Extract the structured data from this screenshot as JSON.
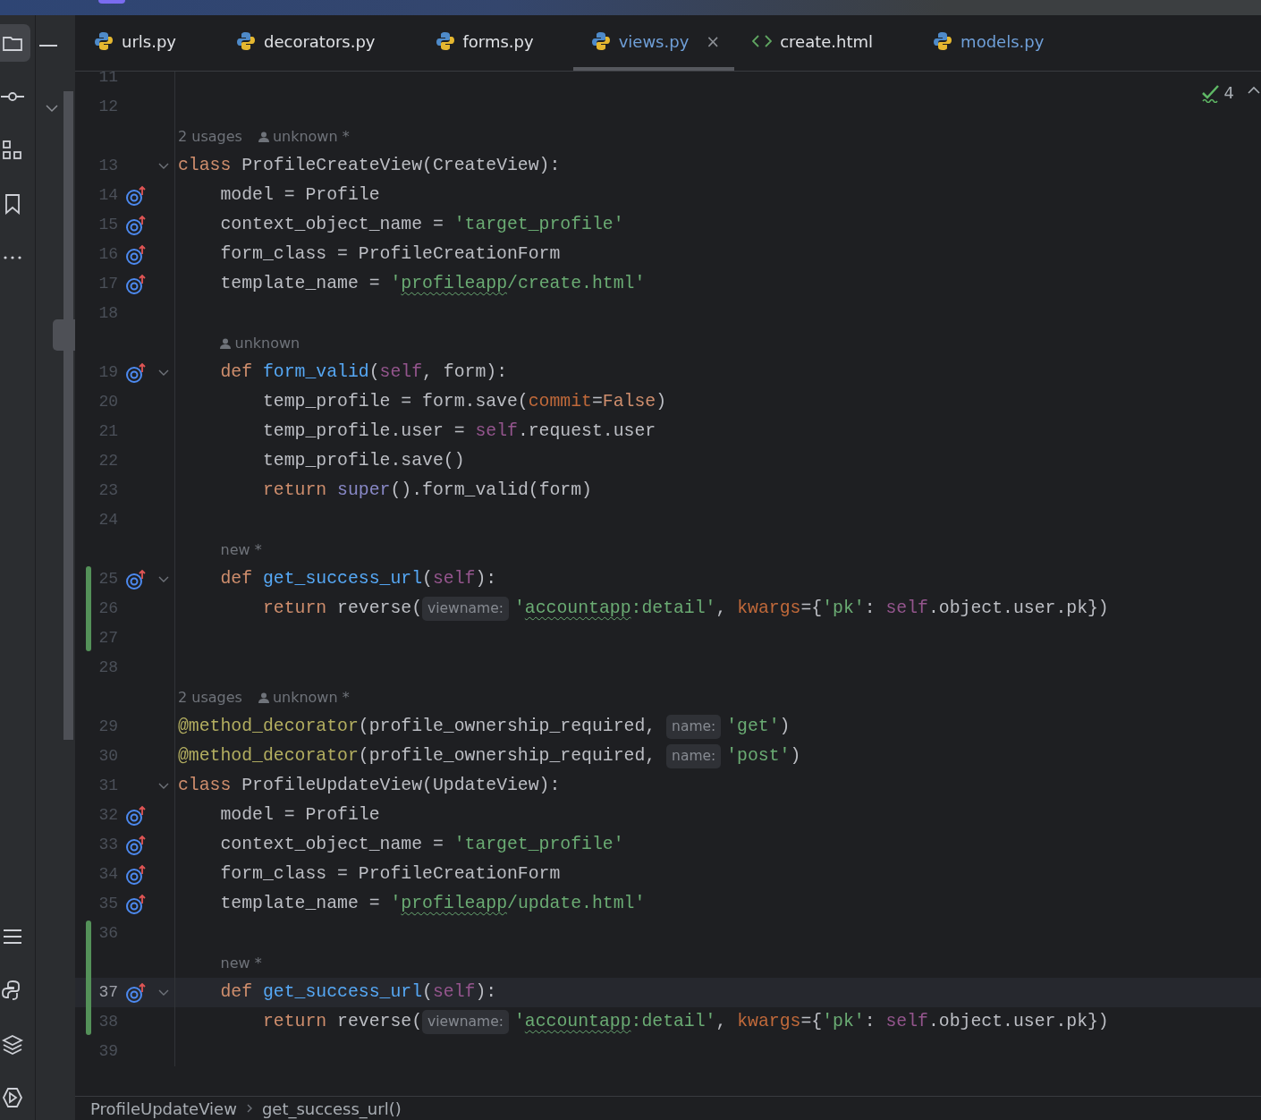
{
  "left_toolbar": {
    "top": [
      {
        "kind": "project",
        "selected": true
      },
      {
        "kind": "commit",
        "selected": false
      },
      {
        "kind": "structure",
        "selected": false
      },
      {
        "kind": "bookmarks",
        "selected": false
      },
      {
        "kind": "more",
        "selected": false
      }
    ],
    "bottom": [
      {
        "kind": "todo",
        "selected": false
      },
      {
        "kind": "python",
        "selected": false
      },
      {
        "kind": "layers",
        "selected": false
      },
      {
        "kind": "run",
        "selected": false
      }
    ]
  },
  "tabs": [
    {
      "label": "urls.py",
      "kind": "python",
      "selected": false,
      "modified": false
    },
    {
      "label": "decorators.py",
      "kind": "python",
      "selected": false,
      "modified": false
    },
    {
      "label": "forms.py",
      "kind": "python",
      "selected": false,
      "modified": false
    },
    {
      "label": "views.py",
      "kind": "python",
      "selected": true,
      "modified": true,
      "close": "×"
    },
    {
      "label": "create.html",
      "kind": "html",
      "selected": false,
      "modified": false
    },
    {
      "label": "models.py",
      "kind": "python",
      "selected": false,
      "modified": true
    }
  ],
  "problems": {
    "count": "4"
  },
  "rows": [
    {
      "number": "11",
      "fold": false,
      "override": false,
      "changed": false,
      "current": false,
      "tokens": []
    },
    {
      "number": "12",
      "fold": false,
      "override": false,
      "changed": false,
      "current": false,
      "tokens": []
    },
    {
      "number": "13",
      "fold": true,
      "override": false,
      "changed": false,
      "current": false,
      "above": [
        {
          "kind": "usages",
          "text": "2 usages"
        },
        {
          "kind": "author",
          "text": "unknown *"
        }
      ],
      "tokens": [
        {
          "kind": "keyword",
          "text": "class"
        },
        {
          "kind": "plain",
          "text": " ProfileCreateView(CreateView):"
        }
      ]
    },
    {
      "number": "14",
      "fold": false,
      "override": true,
      "changed": false,
      "current": false,
      "tokens": [
        {
          "kind": "plain",
          "text": "    model = Profile"
        }
      ]
    },
    {
      "number": "15",
      "fold": false,
      "override": true,
      "changed": false,
      "current": false,
      "tokens": [
        {
          "kind": "plain",
          "text": "    context_object_name = "
        },
        {
          "kind": "string",
          "text": "'target_profile'"
        }
      ]
    },
    {
      "number": "16",
      "fold": false,
      "override": true,
      "changed": false,
      "current": false,
      "tokens": [
        {
          "kind": "plain",
          "text": "    form_class = ProfileCreationForm"
        }
      ]
    },
    {
      "number": "17",
      "fold": false,
      "override": true,
      "changed": false,
      "current": false,
      "tokens": [
        {
          "kind": "plain",
          "text": "    template_name = "
        },
        {
          "kind": "string",
          "text": "'"
        },
        {
          "kind": "string",
          "text": "profileapp",
          "typo": true
        },
        {
          "kind": "string",
          "text": "/create.html'"
        }
      ]
    },
    {
      "number": "18",
      "fold": false,
      "override": false,
      "changed": false,
      "current": false,
      "tokens": []
    },
    {
      "number": "19",
      "fold": true,
      "override": true,
      "changed": false,
      "current": false,
      "above": [
        {
          "kind": "author",
          "text": "unknown"
        }
      ],
      "tokens": [
        {
          "kind": "keyword",
          "text": "    def"
        },
        {
          "kind": "function",
          "text": " form_valid"
        },
        {
          "kind": "plain",
          "text": "("
        },
        {
          "kind": "self",
          "text": "self"
        },
        {
          "kind": "plain",
          "text": ", form):"
        }
      ]
    },
    {
      "number": "20",
      "fold": false,
      "override": false,
      "changed": false,
      "current": false,
      "tokens": [
        {
          "kind": "plain",
          "text": "        temp_profile = form.save("
        },
        {
          "kind": "argument",
          "text": "commit"
        },
        {
          "kind": "plain",
          "text": "="
        },
        {
          "kind": "keyword",
          "text": "False"
        },
        {
          "kind": "plain",
          "text": ")"
        }
      ]
    },
    {
      "number": "21",
      "fold": false,
      "override": false,
      "changed": false,
      "current": false,
      "tokens": [
        {
          "kind": "plain",
          "text": "        temp_profile.user = "
        },
        {
          "kind": "self",
          "text": "self"
        },
        {
          "kind": "plain",
          "text": ".request.user"
        }
      ]
    },
    {
      "number": "22",
      "fold": false,
      "override": false,
      "changed": false,
      "current": false,
      "tokens": [
        {
          "kind": "plain",
          "text": "        temp_profile.save()"
        }
      ]
    },
    {
      "number": "23",
      "fold": false,
      "override": false,
      "changed": false,
      "current": false,
      "tokens": [
        {
          "kind": "keyword",
          "text": "        return"
        },
        {
          "kind": "builtin",
          "text": " super"
        },
        {
          "kind": "plain",
          "text": "().form_valid(form)"
        }
      ]
    },
    {
      "number": "24",
      "fold": false,
      "override": false,
      "changed": false,
      "current": false,
      "tokens": []
    },
    {
      "number": "25",
      "fold": true,
      "override": true,
      "changed": true,
      "current": false,
      "above": [
        {
          "kind": "note",
          "text": "new *"
        }
      ],
      "tokens": [
        {
          "kind": "keyword",
          "text": "    def"
        },
        {
          "kind": "function",
          "text": " get_success_url"
        },
        {
          "kind": "plain",
          "text": "("
        },
        {
          "kind": "self",
          "text": "self"
        },
        {
          "kind": "plain",
          "text": "):"
        }
      ]
    },
    {
      "number": "26",
      "fold": false,
      "override": false,
      "changed": true,
      "current": false,
      "tokens": [
        {
          "kind": "keyword",
          "text": "        return"
        },
        {
          "kind": "plain",
          "text": " reverse("
        },
        {
          "kind": "hint",
          "text": "viewname:"
        },
        {
          "kind": "string",
          "text": "'"
        },
        {
          "kind": "string",
          "text": "accountapp",
          "typo": true
        },
        {
          "kind": "string",
          "text": ":detail'"
        },
        {
          "kind": "plain",
          "text": ", "
        },
        {
          "kind": "argument",
          "text": "kwargs"
        },
        {
          "kind": "plain",
          "text": "={"
        },
        {
          "kind": "string",
          "text": "'pk'"
        },
        {
          "kind": "plain",
          "text": ": "
        },
        {
          "kind": "self",
          "text": "self"
        },
        {
          "kind": "plain",
          "text": ".object.user.pk})"
        }
      ]
    },
    {
      "number": "27",
      "fold": false,
      "override": false,
      "changed": true,
      "current": false,
      "tokens": []
    },
    {
      "number": "28",
      "fold": false,
      "override": false,
      "changed": false,
      "current": false,
      "tokens": []
    },
    {
      "number": "29",
      "fold": false,
      "override": false,
      "changed": false,
      "current": false,
      "above": [
        {
          "kind": "usages",
          "text": "2 usages"
        },
        {
          "kind": "author",
          "text": "unknown *"
        }
      ],
      "tokens": [
        {
          "kind": "decorator",
          "text": "@method_decorator"
        },
        {
          "kind": "plain",
          "text": "(profile_ownership_required, "
        },
        {
          "kind": "hint",
          "text": "name:"
        },
        {
          "kind": "string",
          "text": "'get'"
        },
        {
          "kind": "plain",
          "text": ")"
        }
      ]
    },
    {
      "number": "30",
      "fold": false,
      "override": false,
      "changed": false,
      "current": false,
      "tokens": [
        {
          "kind": "decorator",
          "text": "@method_decorator"
        },
        {
          "kind": "plain",
          "text": "(profile_ownership_required, "
        },
        {
          "kind": "hint",
          "text": "name:"
        },
        {
          "kind": "string",
          "text": "'post'"
        },
        {
          "kind": "plain",
          "text": ")"
        }
      ]
    },
    {
      "number": "31",
      "fold": true,
      "override": false,
      "changed": false,
      "current": false,
      "tokens": [
        {
          "kind": "keyword",
          "text": "class"
        },
        {
          "kind": "plain",
          "text": " ProfileUpdateView(UpdateView):"
        }
      ]
    },
    {
      "number": "32",
      "fold": false,
      "override": true,
      "changed": false,
      "current": false,
      "tokens": [
        {
          "kind": "plain",
          "text": "    model = Profile"
        }
      ]
    },
    {
      "number": "33",
      "fold": false,
      "override": true,
      "changed": false,
      "current": false,
      "tokens": [
        {
          "kind": "plain",
          "text": "    context_object_name = "
        },
        {
          "kind": "string",
          "text": "'target_profile'"
        }
      ]
    },
    {
      "number": "34",
      "fold": false,
      "override": true,
      "changed": false,
      "current": false,
      "tokens": [
        {
          "kind": "plain",
          "text": "    form_class = ProfileCreationForm"
        }
      ]
    },
    {
      "number": "35",
      "fold": false,
      "override": true,
      "changed": false,
      "current": false,
      "tokens": [
        {
          "kind": "plain",
          "text": "    template_name = "
        },
        {
          "kind": "string",
          "text": "'"
        },
        {
          "kind": "string",
          "text": "profileapp",
          "typo": true
        },
        {
          "kind": "string",
          "text": "/update.html'"
        }
      ]
    },
    {
      "number": "36",
      "fold": false,
      "override": false,
      "changed": true,
      "current": false,
      "tokens": []
    },
    {
      "number": "37",
      "fold": true,
      "override": true,
      "changed": true,
      "current": true,
      "above": [
        {
          "kind": "note",
          "text": "new *"
        }
      ],
      "tokens": [
        {
          "kind": "keyword",
          "text": "    def"
        },
        {
          "kind": "function",
          "text": " get_success_url"
        },
        {
          "kind": "plain",
          "text": "("
        },
        {
          "kind": "self",
          "text": "self"
        },
        {
          "kind": "plain",
          "text": "):"
        }
      ]
    },
    {
      "number": "38",
      "fold": false,
      "override": false,
      "changed": true,
      "current": false,
      "tokens": [
        {
          "kind": "keyword",
          "text": "        return"
        },
        {
          "kind": "plain",
          "text": " reverse("
        },
        {
          "kind": "hint",
          "text": "viewname:"
        },
        {
          "kind": "string",
          "text": "'"
        },
        {
          "kind": "string",
          "text": "accountapp",
          "typo": true
        },
        {
          "kind": "string",
          "text": ":detail'"
        },
        {
          "kind": "plain",
          "text": ", "
        },
        {
          "kind": "argument",
          "text": "kwargs"
        },
        {
          "kind": "plain",
          "text": "={"
        },
        {
          "kind": "string",
          "text": "'pk'"
        },
        {
          "kind": "plain",
          "text": ": "
        },
        {
          "kind": "self",
          "text": "self"
        },
        {
          "kind": "plain",
          "text": ".object.user.pk})"
        }
      ]
    },
    {
      "number": "39",
      "fold": false,
      "override": false,
      "changed": false,
      "current": false,
      "tokens": []
    }
  ],
  "breadcrumbs": [
    "ProfileUpdateView",
    "get_success_url()"
  ]
}
